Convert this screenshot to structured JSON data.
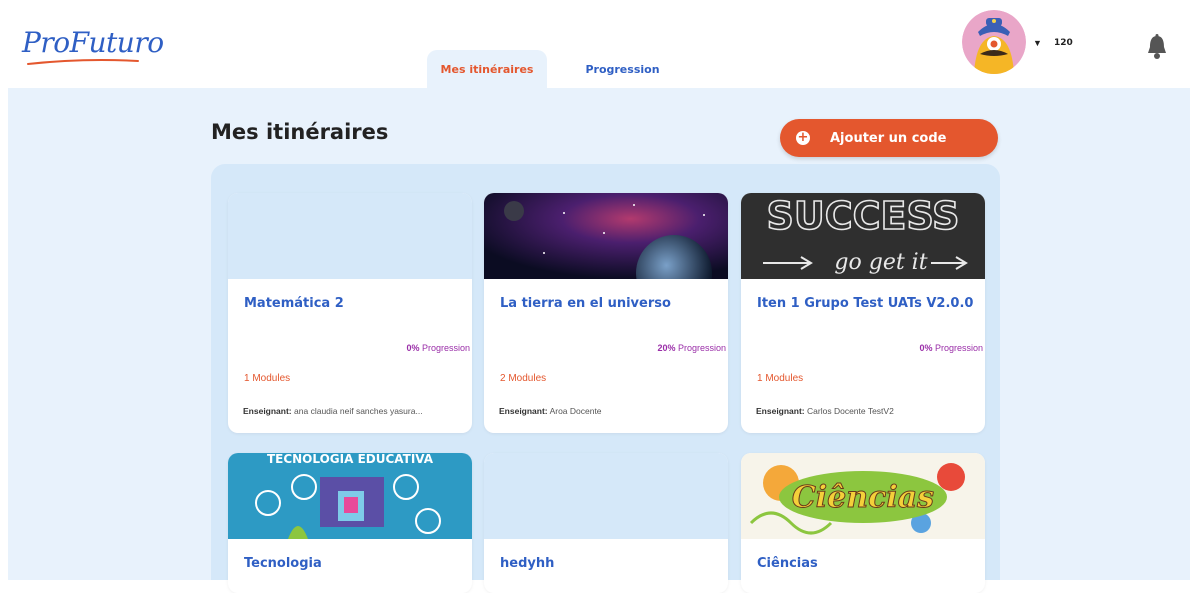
{
  "header": {
    "logo": "ProFuturo",
    "tabs": [
      {
        "label": "Mes itinéraires",
        "active": true
      },
      {
        "label": "Progression",
        "active": false
      }
    ],
    "points": "120"
  },
  "main": {
    "title": "Mes itinéraires",
    "add_button": "Ajouter un code"
  },
  "labels": {
    "progression": "Progression",
    "teacher": "Enseignant:"
  },
  "cards": [
    {
      "title": "Matemática 2",
      "progress": "0%",
      "modules": "1 Modules",
      "teacher": "ana claudia neif sanches yasura..."
    },
    {
      "title": "La tierra en el universo",
      "progress": "20%",
      "modules": "2 Modules",
      "teacher": "Aroa Docente"
    },
    {
      "title": "Iten 1 Grupo Test UATs V2.0.0",
      "progress": "0%",
      "modules": "1 Modules",
      "teacher": "Carlos Docente TestV2"
    },
    {
      "title": "Tecnologia"
    },
    {
      "title": "hedyhh"
    },
    {
      "title": "Ciências"
    }
  ],
  "image_text": {
    "success": "SUCCESS",
    "go_get_it": "go get it",
    "tecnologia_educativa": "TECNOLOGIA EDUCATIVA",
    "ciencias": "Ciências"
  },
  "colors": {
    "brand_blue": "#2f5fc4",
    "accent_orange": "#e4572e",
    "progress_purple": "#9a2ea8",
    "panel_bg": "#e8f2fc"
  },
  "icons": {
    "add": "plus-circle-icon",
    "notifications": "bell-icon",
    "dropdown": "caret-down-icon"
  }
}
